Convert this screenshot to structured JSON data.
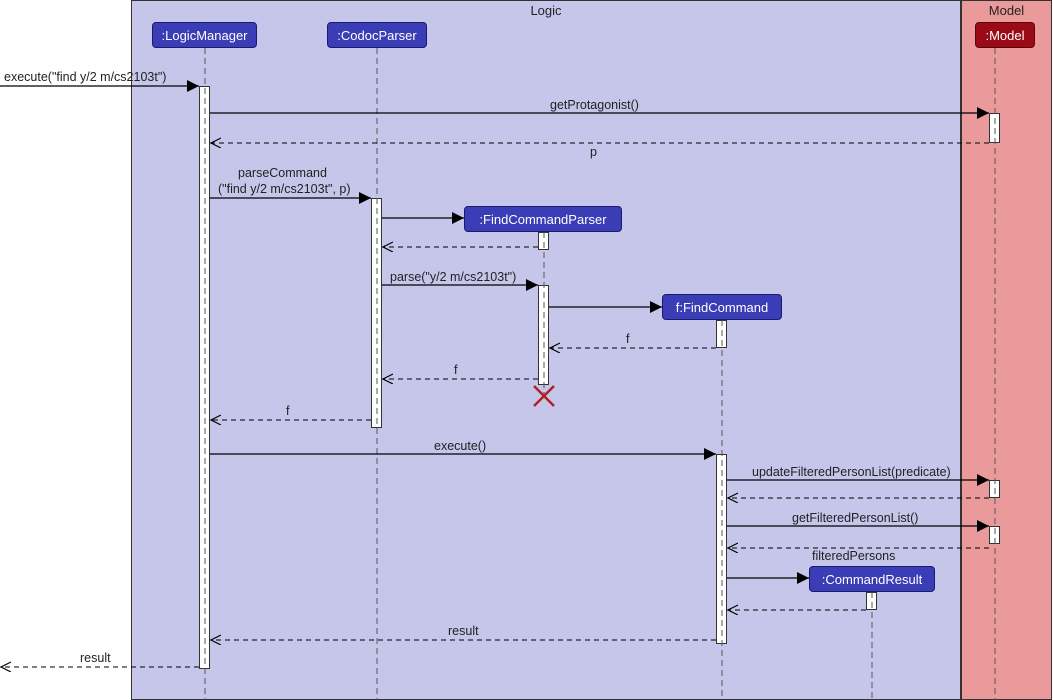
{
  "frames": {
    "logic_title": "Logic",
    "model_title": "Model"
  },
  "participants": {
    "logicManager": ":LogicManager",
    "codocParser": ":CodocParser",
    "findCommandParser": ":FindCommandParser",
    "findCommand": "f:FindCommand",
    "commandResult": ":CommandResult",
    "model": ":Model"
  },
  "messages": {
    "execute_find": "execute(\"find y/2 m/cs2103t\")",
    "getProtagonist": "getProtagonist()",
    "p": "p",
    "parseCommand1": "parseCommand",
    "parseCommand2": "(\"find y/2 m/cs2103t\", p)",
    "parse": "parse(\"y/2 m/cs2103t\")",
    "f": "f",
    "execute": "execute()",
    "updateFilteredPersonList": "updateFilteredPersonList(predicate)",
    "getFilteredPersonList": "getFilteredPersonList()",
    "filteredPersons": "filteredPersons",
    "result": "result"
  }
}
